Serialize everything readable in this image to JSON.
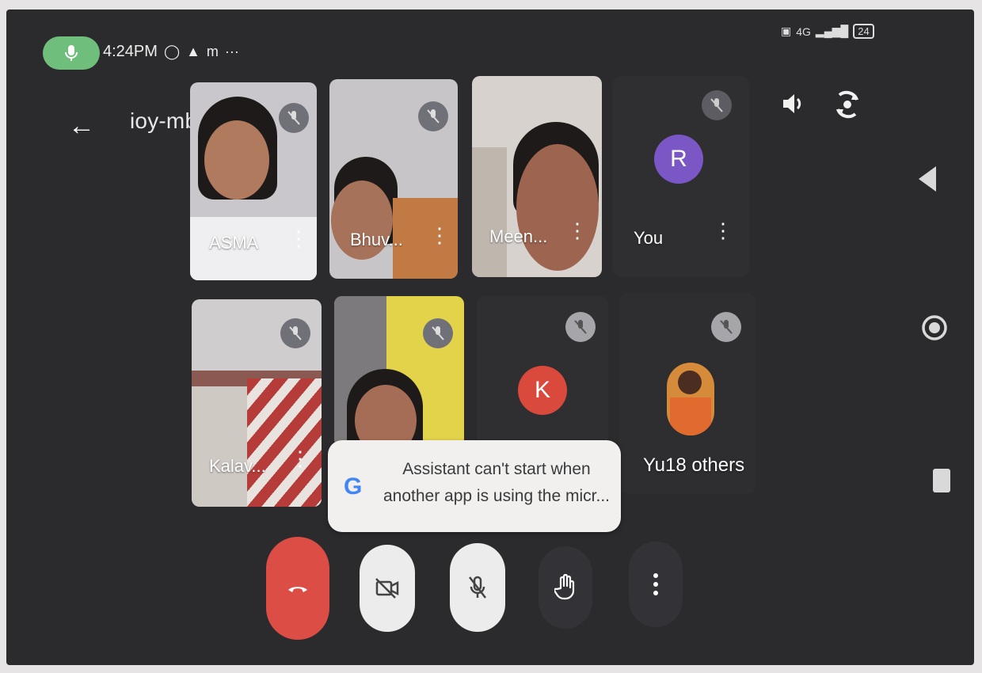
{
  "status_bar": {
    "time": "4:24PM",
    "icons": [
      "mic-active-icon",
      "whatsapp-icon",
      "drive-icon",
      "gmail-icon",
      "more-icon"
    ],
    "network": "4G",
    "battery": "24"
  },
  "header": {
    "meeting_code": "ioy-mbzy-djz"
  },
  "participants": [
    {
      "name": "ASMA",
      "muted": true
    },
    {
      "name": "Bhuv...",
      "muted": true
    },
    {
      "name": "Meen...",
      "muted": false
    },
    {
      "name": "You",
      "initial": "R",
      "muted": true,
      "avatar_color": "#7b57c6"
    },
    {
      "name": "Kalav...",
      "muted": true
    },
    {
      "name": "",
      "muted": true
    },
    {
      "name": "",
      "initial": "K",
      "muted": true,
      "avatar_color": "#d9493c"
    },
    {
      "name": "Yu18 others",
      "muted": true
    }
  ],
  "toast": {
    "message": "Assistant can't start when another app is using the micr..."
  },
  "controls": [
    "end-call",
    "camera-off",
    "mic-off",
    "raise-hand",
    "more-options"
  ],
  "colors": {
    "end_call": "#dc4d45",
    "toast_bg": "#f1f0ef",
    "google_blue": "#4285f4"
  }
}
